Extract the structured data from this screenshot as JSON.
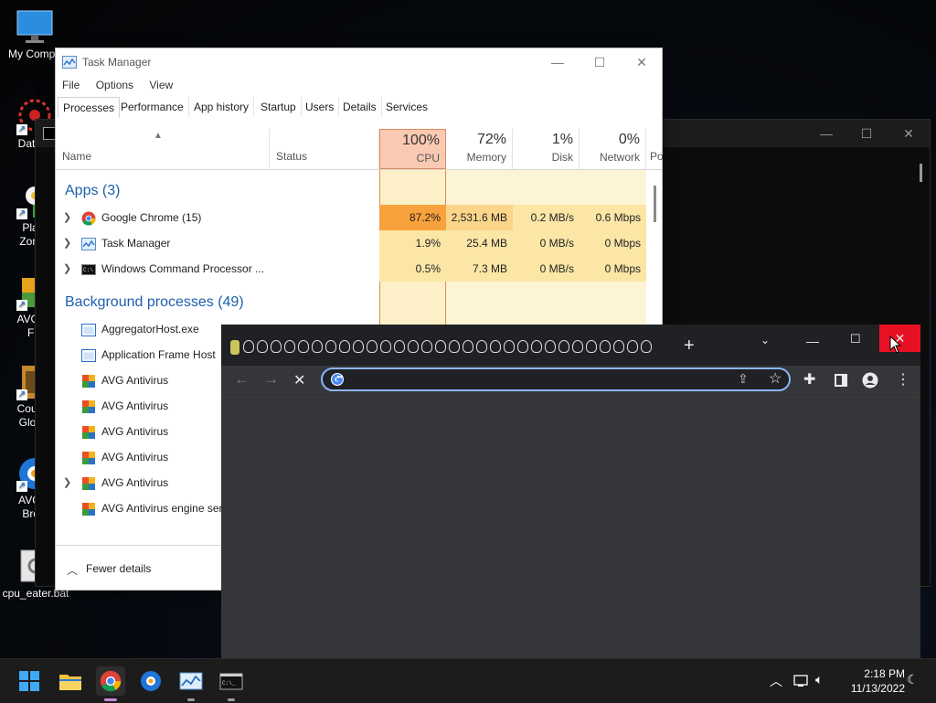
{
  "desktop": {
    "icons": [
      {
        "label": "My Compu"
      },
      {
        "label": "DataW"
      },
      {
        "label": "Plant"
      },
      {
        "label": "Zombi"
      },
      {
        "label": "AVG Ar"
      },
      {
        "label": "FR"
      },
      {
        "label": "Counte"
      },
      {
        "label": "Global"
      },
      {
        "label": "AVG S"
      },
      {
        "label": "Brow"
      },
      {
        "label": "cpu_eater.bat"
      }
    ]
  },
  "task_manager": {
    "title": "Task Manager",
    "menu": [
      "File",
      "Options",
      "View"
    ],
    "tabs": [
      "Processes",
      "Performance",
      "App history",
      "Startup",
      "Users",
      "Details",
      "Services"
    ],
    "columns": {
      "name": "Name",
      "status": "Status",
      "cpu": {
        "pct": "100%",
        "label": "CPU"
      },
      "memory": {
        "pct": "72%",
        "label": "Memory"
      },
      "disk": {
        "pct": "1%",
        "label": "Disk"
      },
      "network": {
        "pct": "0%",
        "label": "Network"
      },
      "power": "Po"
    },
    "groups": {
      "apps": "Apps (3)",
      "background": "Background processes (49)"
    },
    "apps": [
      {
        "name": "Google Chrome (15)",
        "cpu": "87.2%",
        "memory": "2,531.6 MB",
        "disk": "0.2 MB/s",
        "network": "0.6 Mbps"
      },
      {
        "name": "Task Manager",
        "cpu": "1.9%",
        "memory": "25.4 MB",
        "disk": "0 MB/s",
        "network": "0 Mbps"
      },
      {
        "name": "Windows Command Processor ...",
        "cpu": "0.5%",
        "memory": "7.3 MB",
        "disk": "0 MB/s",
        "network": "0 Mbps"
      }
    ],
    "background": [
      {
        "name": "AggregatorHost.exe"
      },
      {
        "name": "Application Frame Host"
      },
      {
        "name": "AVG Antivirus"
      },
      {
        "name": "AVG Antivirus"
      },
      {
        "name": "AVG Antivirus"
      },
      {
        "name": "AVG Antivirus"
      },
      {
        "name": "AVG Antivirus"
      },
      {
        "name": "AVG Antivirus engine serv"
      }
    ],
    "footer": "Fewer details"
  },
  "chrome": {
    "omnibox_value": "",
    "new_tab": "+"
  },
  "taskbar": {
    "time": "2:18 PM",
    "date": "11/13/2022"
  },
  "colors": {
    "cpu_high": "#f7a23c",
    "cpu_header": "#fac9b2",
    "cell_light": "#fdf0c8",
    "group_blue": "#1d5fae",
    "close_red": "#e81123"
  }
}
